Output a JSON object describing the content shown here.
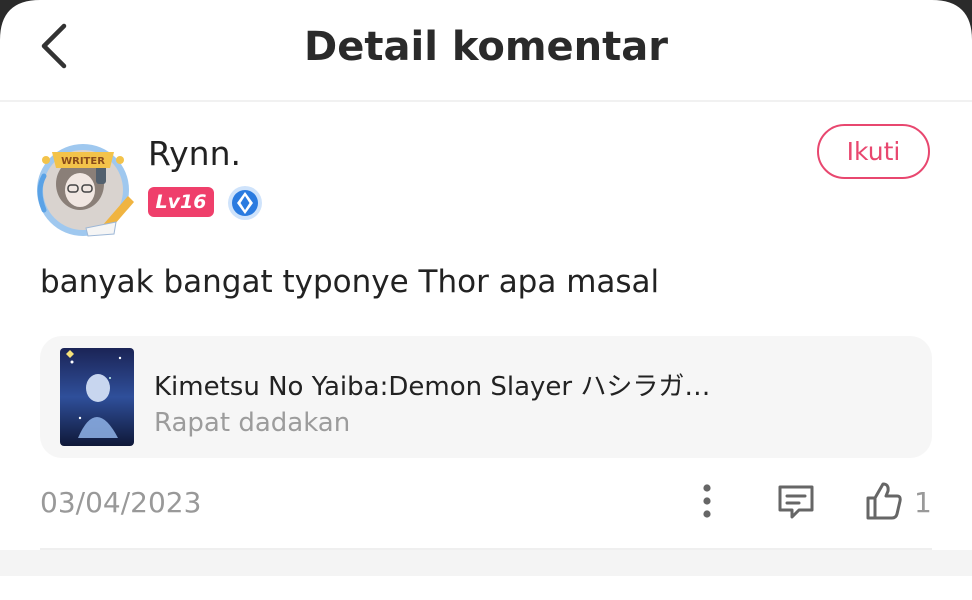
{
  "header": {
    "title": "Detail komentar",
    "back_icon": "chevron-left-icon"
  },
  "user": {
    "avatar_badge": "WRITER",
    "name": "Rynn.",
    "level": "Lv16",
    "level_color": "#ef3f6b",
    "badge_icon": "blue-diamond-badge-icon"
  },
  "follow_button": {
    "label": "Ikuti",
    "color": "#e8476f"
  },
  "comment": {
    "text": "banyak bangat typonye Thor apa masal"
  },
  "book": {
    "title": "Kimetsu No Yaiba:Demon Slayer ハシラガ…",
    "subtitle": "Rapat dadakan"
  },
  "footer": {
    "date": "03/04/2023",
    "more_icon": "more-vertical-icon",
    "reply_icon": "comment-icon",
    "like_icon": "thumbs-up-icon",
    "like_count": "1"
  }
}
